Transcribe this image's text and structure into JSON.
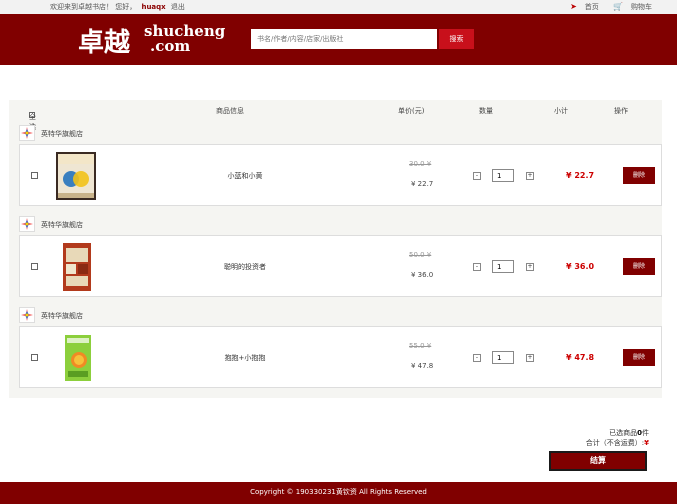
{
  "topbar": {
    "welcome": "欢迎来到卓越书店！",
    "greeting": "您好，",
    "username": "huaqx",
    "logout": "退出",
    "home": "首页",
    "cart": "购物车"
  },
  "header": {
    "logo_cn": "卓越",
    "logo_en1": "shucheng",
    "logo_en2": ".com",
    "search_placeholder": "书名/作者/内容/店家/出版社",
    "search_button": "搜索"
  },
  "cart_head": {
    "select_all": "全选",
    "product": "商品信息",
    "unit_price": "单价(元)",
    "quantity": "数量",
    "subtotal": "小计",
    "action": "操作"
  },
  "items": [
    {
      "shop": "英特华旗舰店",
      "name": "小蓝和小黄",
      "old_price": "30.0 ¥",
      "price": "¥ 22.7",
      "qty": "1",
      "subtotal": "¥ 22.7",
      "delete": "删除"
    },
    {
      "shop": "英特华旗舰店",
      "name": "聪明的投资者",
      "old_price": "50.0 ¥",
      "price": "¥ 36.0",
      "qty": "1",
      "subtotal": "¥ 36.0",
      "delete": "删除"
    },
    {
      "shop": "英特华旗舰店",
      "name": "抱抱+小抱抱",
      "old_price": "55.0 ¥",
      "price": "¥ 47.8",
      "qty": "1",
      "subtotal": "¥ 47.8",
      "delete": "删除"
    }
  ],
  "summary": {
    "selected_prefix": "已选商品",
    "selected_count": "0",
    "selected_suffix": "件",
    "total_label": "合计（不含运费）:",
    "currency": "¥",
    "checkout": "结算"
  },
  "footer": {
    "copyright": "Copyright © 190330231黄钦资 All Rights Reserved"
  },
  "colors": {
    "brand": "#800000",
    "search_button": "#c8101b",
    "price_red": "#cc0000"
  }
}
